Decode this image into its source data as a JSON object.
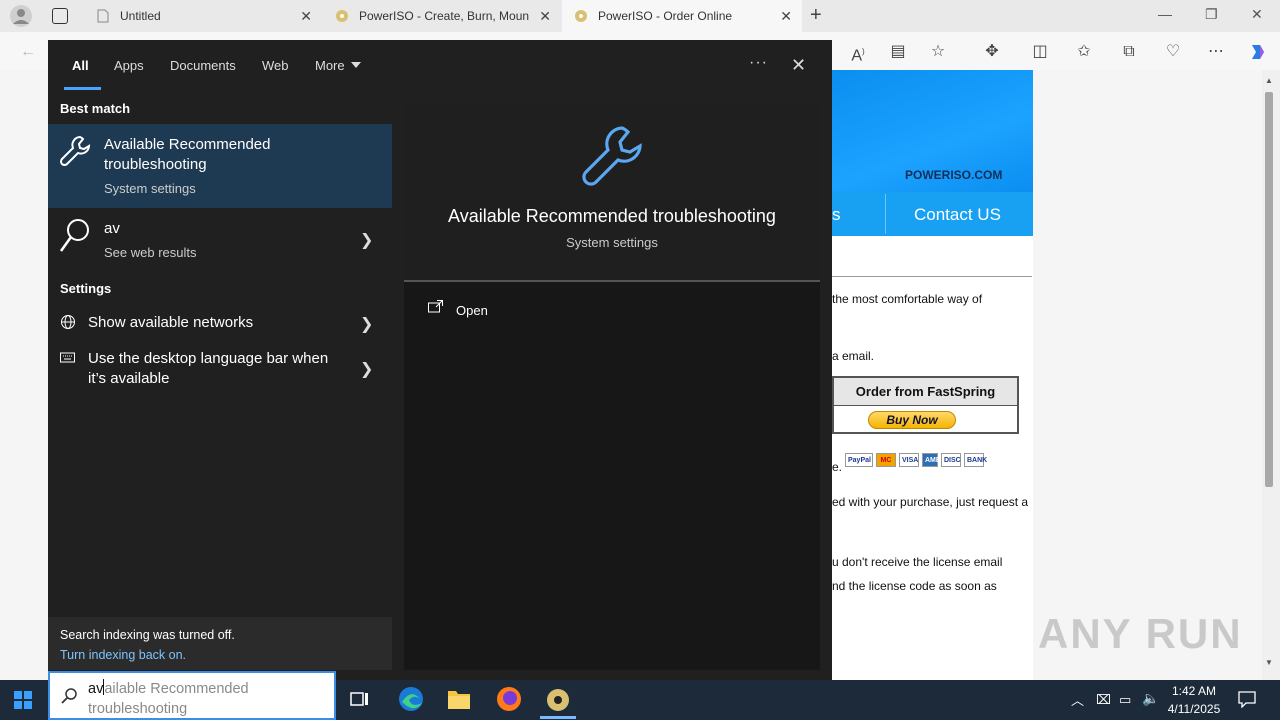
{
  "browser": {
    "tabs": [
      {
        "title": "Untitled"
      },
      {
        "title": "PowerISO - Create, Burn, Mount,"
      },
      {
        "title": "PowerISO - Order Online"
      }
    ]
  },
  "webpage": {
    "banner_text": "POWERISO.COM",
    "nav_partial": "s",
    "nav_contact": "Contact US",
    "line1": "the most comfortable way of",
    "line2": "a email.",
    "order_header": "Order from FastSpring",
    "buy_now": "Buy Now",
    "line3": "e.",
    "line4": "ed with your purchase, just request a",
    "line5": "u don't receive the license email",
    "line6": "nd the license code as soon as",
    "pay_logos": [
      "PayPal",
      "MC",
      "VISA",
      "AMEX",
      "DISC",
      "BANK"
    ],
    "watermark": "ANY RUN"
  },
  "search_panel": {
    "tabs": [
      "All",
      "Apps",
      "Documents",
      "Web",
      "More"
    ],
    "best_match_heading": "Best match",
    "best_match": {
      "title_line1": "Available Recommended",
      "title_line2": "troubleshooting",
      "subtitle": "System settings"
    },
    "web_result": {
      "title": "av",
      "subtitle": "See web results"
    },
    "settings_heading": "Settings",
    "settings_items": [
      {
        "line1": "Show available networks",
        "line2": ""
      },
      {
        "line1": "Use the desktop language bar when",
        "line2": "it’s available"
      }
    ],
    "preview": {
      "title": "Available Recommended troubleshooting",
      "subtitle": "System settings",
      "action": "Open"
    },
    "indexing": {
      "message": "Search indexing was turned off.",
      "link": "Turn indexing back on."
    }
  },
  "taskbar": {
    "search_typed": "av",
    "search_suggest_line1": "ailable Recommended",
    "search_suggest_line2": "troubleshooting",
    "time": "1:42 AM",
    "date": "4/11/2025"
  }
}
